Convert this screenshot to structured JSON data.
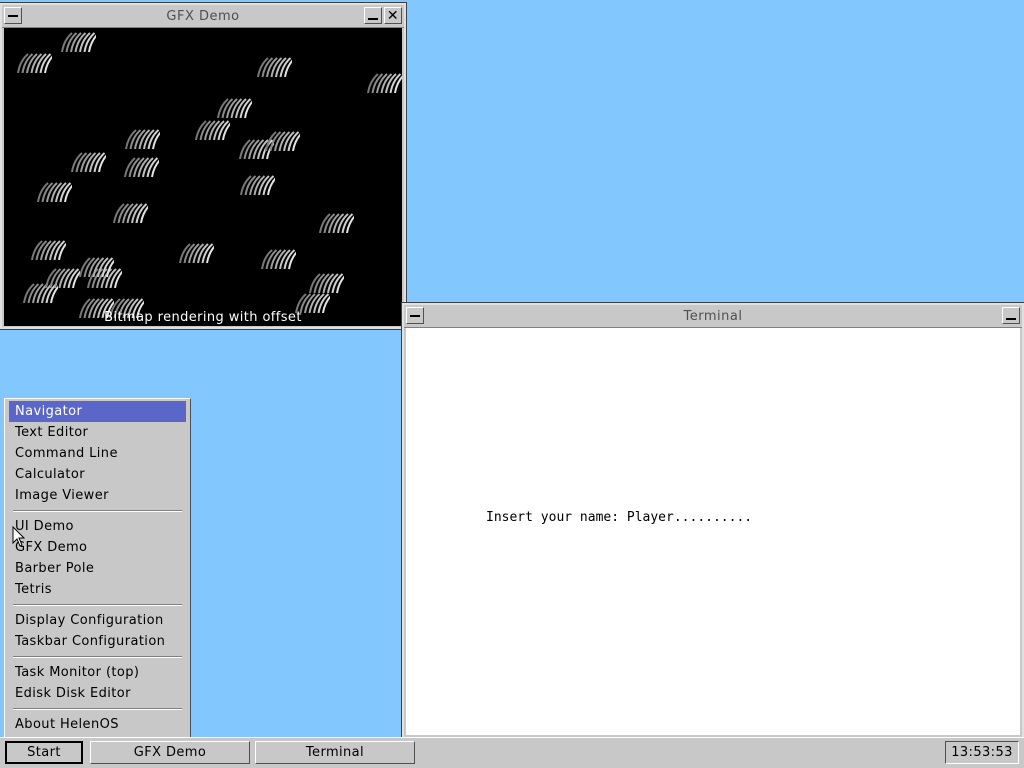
{
  "gfx_window": {
    "title": "GFX Demo",
    "caption": "Bitmap rendering with offset"
  },
  "terminal_window": {
    "title": "Terminal",
    "text": "Insert your name: Player.........."
  },
  "start_menu": {
    "items": [
      {
        "label": "Navigator",
        "selected": true
      },
      {
        "label": "Text Editor"
      },
      {
        "label": "Command Line"
      },
      {
        "label": "Calculator"
      },
      {
        "label": "Image Viewer"
      },
      {
        "separator": true
      },
      {
        "label": "UI Demo"
      },
      {
        "label": "GFX Demo"
      },
      {
        "label": "Barber Pole"
      },
      {
        "label": "Tetris"
      },
      {
        "separator": true
      },
      {
        "label": "Display Configuration"
      },
      {
        "label": "Taskbar Configuration"
      },
      {
        "separator": true
      },
      {
        "label": "Task Monitor (top)"
      },
      {
        "label": "Edisk Disk Editor"
      },
      {
        "separator": true
      },
      {
        "label": "About HelenOS"
      }
    ]
  },
  "taskbar": {
    "start_label": "Start",
    "tasks": [
      {
        "label": "GFX Demo"
      },
      {
        "label": "Terminal"
      }
    ],
    "clock": "13:53:53"
  },
  "colors": {
    "desktop": "#82c8ff",
    "menu_highlight": "#5b67c8",
    "chrome": "#c8c8c8"
  },
  "icons": [
    "minimize-icon",
    "close-icon",
    "window-menu-icon",
    "mouse-cursor-icon"
  ]
}
